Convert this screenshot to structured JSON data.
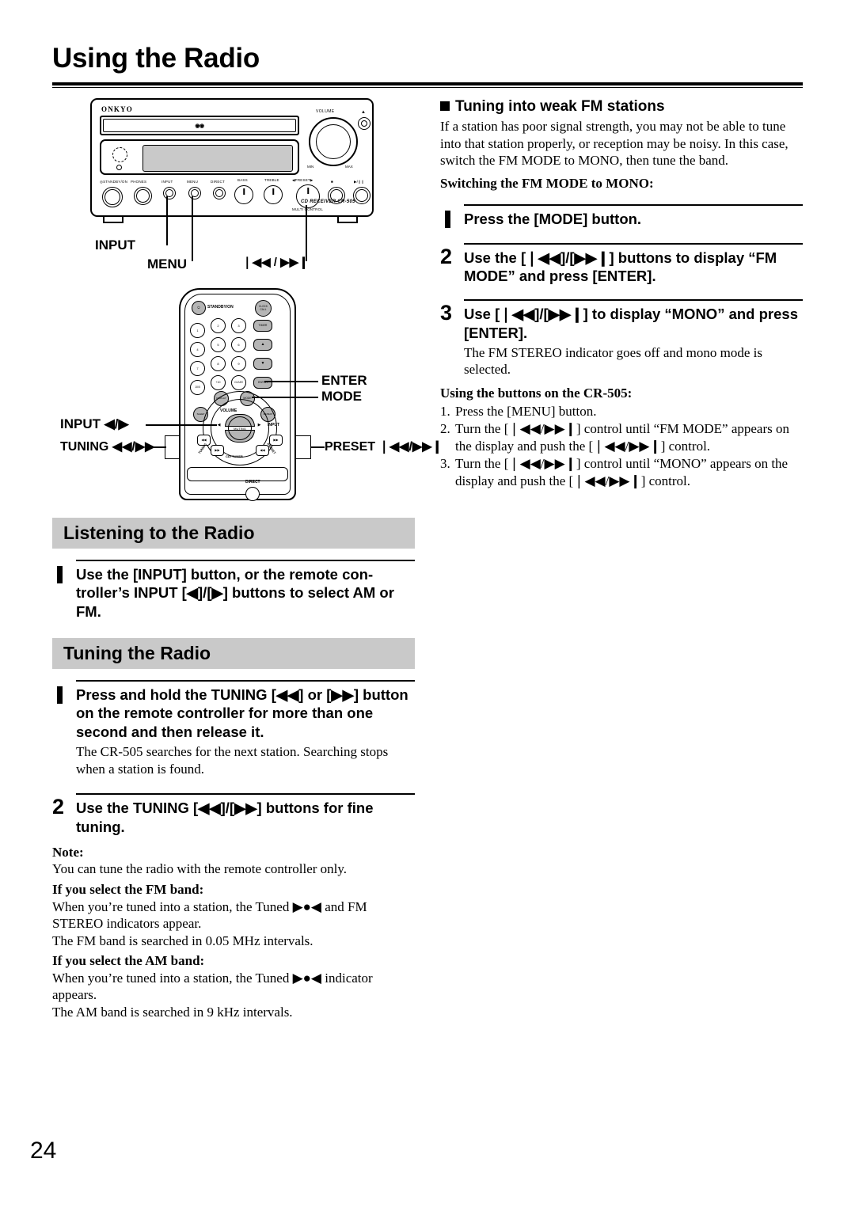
{
  "page": {
    "title": "Using the Radio",
    "number": "24"
  },
  "figure_receiver": {
    "brand": "ONKYO",
    "cd_logo": "COMPACT DISC DIGITAL AUDIO",
    "volume_label": "VOLUME",
    "volume_min": "MIN",
    "volume_max": "MAX",
    "model": "CD RECEIVER CR-505",
    "controls": [
      "STANDBY/ON",
      "PHONES",
      "INPUT",
      "MENU",
      "DIRECT",
      "BASS",
      "TREBLE",
      "PRESET",
      "MULTI CONTROL"
    ],
    "callouts": [
      {
        "label": "INPUT"
      },
      {
        "label": "MENU"
      },
      {
        "label": "❘◀◀ / ▶▶❙"
      }
    ]
  },
  "figure_remote": {
    "buttons": {
      "standby": "STANDBY/ON",
      "clock_call": "CLOCK CALL",
      "timer": "TIMER",
      "up": "▲",
      "down": "▼",
      "enter": "ENTER",
      "display": "DISPLAY",
      "mode": "MODE",
      "repeat": "REPEAT",
      "random": "RANDOM",
      "input": "INPUT",
      "muting": "MUTING",
      "volume": "VOLUME",
      "cd_tuner": "CD/ TUNER",
      "tuning": "TUNING",
      "preset": "PRESET",
      "direct": "DIRECT",
      "clear": "CLEAR",
      "ten_zero": "10/0",
      "plus_ten": "+10",
      "numbers": [
        "1",
        "2",
        "3",
        "4",
        "5",
        "6",
        "7",
        "8",
        "9"
      ]
    },
    "callouts": {
      "enter": "ENTER",
      "mode": "MODE",
      "input": "INPUT ◀/▶",
      "tuning": "TUNING ◀◀/▶▶",
      "preset": "PRESET ❘◀◀/▶▶❙"
    }
  },
  "left_column": {
    "section1": {
      "heading": "Listening to the Radio",
      "steps": [
        {
          "marker": "bar",
          "text": "Use the [INPUT] button, or the remote con-troller’s INPUT [◀]/[▶] buttons to select AM or FM."
        }
      ]
    },
    "section2": {
      "heading": "Tuning the Radio",
      "step1": {
        "marker": "bar",
        "text": "Press and hold the TUNING [◀◀] or [▶▶] button on the remote controller for more than one second and then release it.",
        "sub": "The CR-505 searches for the next station. Searching stops when a station is found."
      },
      "step2": {
        "num": "2",
        "text": "Use the TUNING [◀◀]/[▶▶] buttons for fine tuning."
      },
      "note_label": "Note:",
      "note_text": "You can tune the radio with the remote controller only.",
      "fm_heading": "If you select the FM band:",
      "fm_text_1": "When you’re tuned into a station, the Tuned ▶●◀ and FM STEREO indicators appear.",
      "fm_text_2": "The FM band is searched in 0.05 MHz intervals.",
      "am_heading": "If you select the AM band:",
      "am_text_1": "When you’re tuned into a station, the Tuned ▶●◀ indicator appears.",
      "am_text_2": "The AM band is searched in 9 kHz intervals."
    }
  },
  "right_column": {
    "heading": "Tuning into weak FM stations",
    "intro": "If a station has poor signal strength, you may not be able to tune into that station properly, or reception may be noisy. In this case, switch the FM MODE to MONO, then tune the band.",
    "subheading": "Switching the FM MODE to MONO:",
    "step1": {
      "marker": "bar",
      "text": "Press the [MODE] button."
    },
    "step2": {
      "num": "2",
      "text": "Use the [❘◀◀]/[▶▶❙] buttons to display “FM MODE” and press [ENTER]."
    },
    "step3": {
      "num": "3",
      "text": "Use [❘◀◀]/[▶▶❙] to display “MONO” and press [ENTER].",
      "sub": "The FM STEREO indicator goes off and mono mode is selected."
    },
    "buttons_heading": "Using the buttons on the CR-505:",
    "numbered_list": [
      {
        "n": "1.",
        "text": "Press the [MENU] button."
      },
      {
        "n": "2.",
        "text": "Turn the [❘◀◀/▶▶❙] control until “FM MODE” appears on the display and push the [❘◀◀/▶▶❙] control."
      },
      {
        "n": "3.",
        "text": "Turn the [❘◀◀/▶▶❙] control until “MONO” appears on the display and push the [❘◀◀/▶▶❙] control."
      }
    ]
  },
  "colors": {
    "heading_band": "#c9c9c9",
    "display_gray": "#c9c9c9",
    "text": "#000000"
  }
}
